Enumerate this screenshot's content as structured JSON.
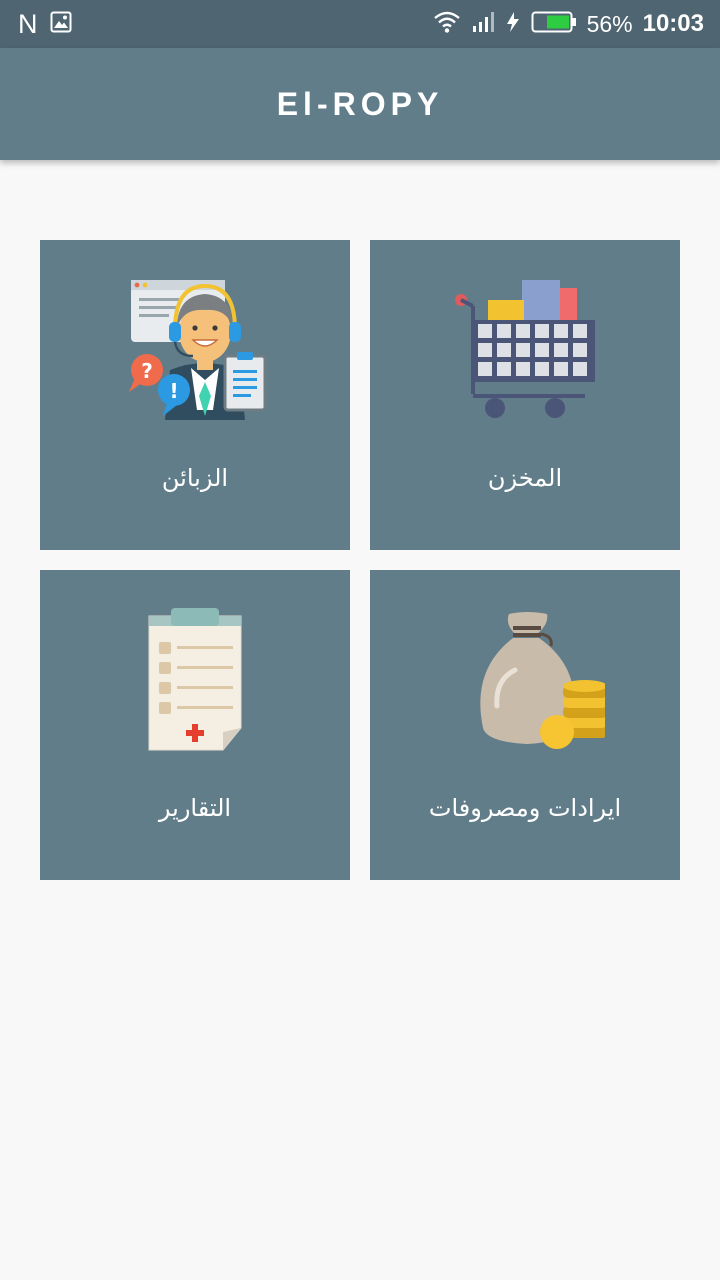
{
  "status_bar": {
    "left_icons": [
      "n-notification-icon",
      "image-notification-icon"
    ],
    "n_glyph": "N",
    "battery_percent": "56%",
    "time": "10:03"
  },
  "app_bar": {
    "title": "El-ROPY"
  },
  "tiles": [
    {
      "label": "الزبائن",
      "icon": "customer-support-icon"
    },
    {
      "label": "المخزن",
      "icon": "shopping-cart-icon"
    },
    {
      "label": "التقارير",
      "icon": "clipboard-report-icon"
    },
    {
      "label": "ايرادات ومصروفات",
      "icon": "money-bag-coins-icon"
    }
  ],
  "colors": {
    "status_bar": "#4f6571",
    "app_bar": "#627d8a",
    "tile": "#627d8a",
    "background": "#f8f8f8",
    "battery_fill": "#2ecc40"
  }
}
